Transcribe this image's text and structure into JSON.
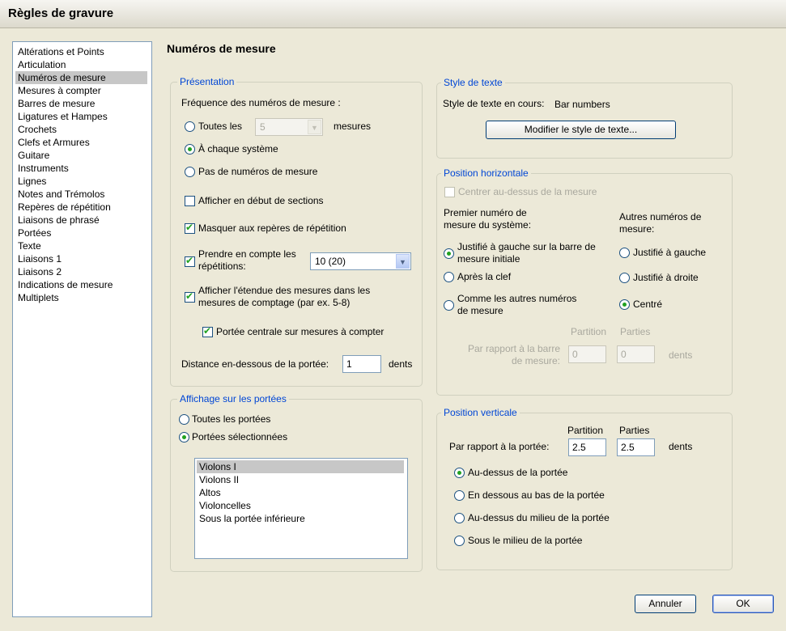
{
  "window": {
    "title": "Règles de gravure"
  },
  "categories": [
    "Altérations et Points",
    "Articulation",
    "Numéros de mesure",
    "Mesures à compter",
    "Barres de mesure",
    "Ligatures et Hampes",
    "Crochets",
    "Clefs et Armures",
    "Guitare",
    "Instruments",
    "Lignes",
    "Notes and Trémolos",
    "Repères de répétition",
    "Liaisons de phrasé",
    "Portées",
    "Texte",
    "Liaisons 1",
    "Liaisons 2",
    "Indications de mesure",
    "Multiplets"
  ],
  "selected_category": "Numéros de mesure",
  "page_title": "Numéros de mesure",
  "presentation": {
    "legend": "Présentation",
    "frequency_label": "Fréquence des numéros de mesure :",
    "every_label": "Toutes les",
    "every_value": "5",
    "every_unit": "mesures",
    "each_system_label": "À chaque système",
    "none_label": "Pas de numéros de mesure",
    "frequency_selected": "each_system",
    "show_section_start": {
      "label": "Afficher en début de sections",
      "checked": false
    },
    "hide_rehearsal": {
      "label": "Masquer aux repères de répétition",
      "checked": true
    },
    "count_repeats": {
      "label_line1": "Prendre en compte les",
      "label_line2": "répétitions:",
      "checked": true,
      "value": "10 (20)"
    },
    "show_range": {
      "label_line1": "Afficher l'étendue des mesures dans les",
      "label_line2": "mesures de comptage (par ex. 5-8)",
      "checked": true
    },
    "central_staff": {
      "label": "Portée centrale sur mesures à compter",
      "checked": true
    },
    "distance_label": "Distance en-dessous de la portée:",
    "distance_value": "1",
    "distance_unit": "dents"
  },
  "staves": {
    "legend": "Affichage sur les portées",
    "all_label": "Toutes les portées",
    "selected_label": "Portées sélectionnées",
    "mode": "selected",
    "list": [
      "Violons I",
      "Violons II",
      "Altos",
      "Violoncelles",
      "Sous la portée inférieure"
    ],
    "list_selected": "Violons I"
  },
  "text_style": {
    "legend": "Style de texte",
    "current_label": "Style de texte en cours:",
    "current_value": "Bar numbers",
    "modify_button": "Modifier le style de texte..."
  },
  "horizontal": {
    "legend": "Position horizontale",
    "center_label": "Centrer au-dessus de la mesure",
    "center_checked": false,
    "first_header_line1": "Premier numéro de",
    "first_header_line2": "mesure du système:",
    "other_header_line1": "Autres numéros de",
    "other_header_line2": "mesure:",
    "first_opt1_line1": "Justifié à gauche sur la barre de",
    "first_opt1_line2": "mesure initiale",
    "first_opt2": "Après la clef",
    "first_opt3_line1": "Comme les autres numéros",
    "first_opt3_line2": "de mesure",
    "first_selected": "left_initial",
    "other_opt1": "Justifié à gauche",
    "other_opt2": "Justifié à droite",
    "other_opt3": "Centré",
    "other_selected": "centered",
    "col_score": "Partition",
    "col_parts": "Parties",
    "relative_line1": "Par rapport à la barre",
    "relative_line2": "de mesure:",
    "score_value": "0",
    "parts_value": "0",
    "unit": "dents"
  },
  "vertical": {
    "legend": "Position verticale",
    "col_score": "Partition",
    "col_parts": "Parties",
    "relative_label": "Par rapport à la portée:",
    "score_value": "2.5",
    "parts_value": "2.5",
    "unit": "dents",
    "opt1": "Au-dessus de la portée",
    "opt2": "En dessous au bas de la portée",
    "opt3": "Au-dessus du milieu de la portée",
    "opt4": "Sous le milieu de la portée",
    "selected": "above"
  },
  "buttons": {
    "cancel": "Annuler",
    "ok": "OK"
  },
  "colors": {
    "dialog_bg": "#ece9d8",
    "group_legend": "#0046d5",
    "check_mark": "#21a121",
    "selection": "#c7c7c7"
  }
}
